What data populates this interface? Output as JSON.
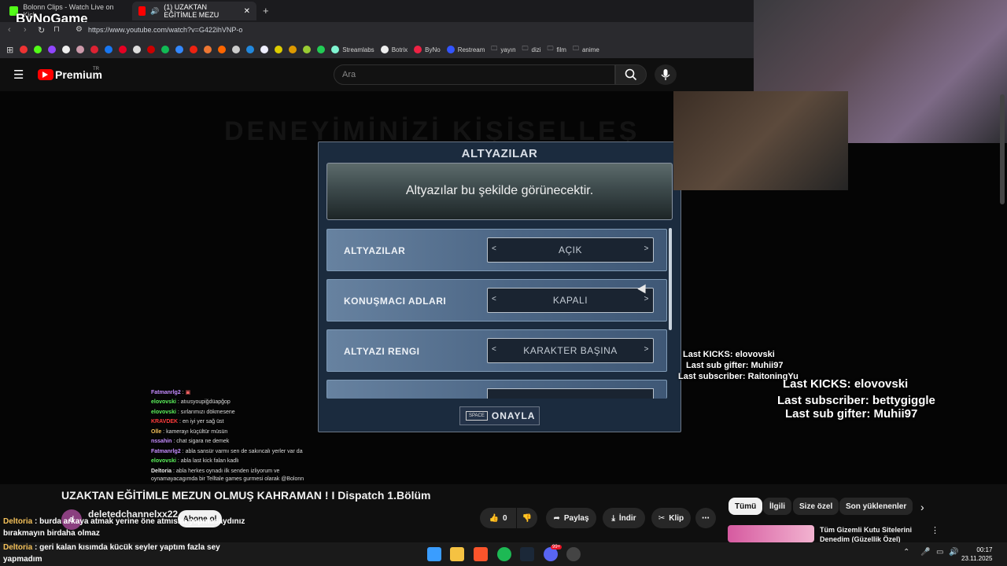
{
  "browser": {
    "tabs": [
      {
        "label": "Bolonn Clips - Watch Live on Kick"
      },
      {
        "label": "(1) UZAKTAN EĞİTİMLE MEZU"
      }
    ],
    "url": "https://www.youtube.com/watch?v=G422ihVNP-o",
    "bookmarks": [
      "Streamlabs",
      "Botrix",
      "ByNo",
      "Restream",
      "yayın",
      "dizi",
      "film",
      "anime"
    ]
  },
  "overlay": {
    "brand": "ByNoGame",
    "kick_small": [
      "Last KICKS: elovovski",
      "Last sub gifter: Muhii97",
      "Last subscriber: RaitoningYu"
    ],
    "kick_large": [
      "Last KICKS: elovovski",
      "Last subscriber: bettygiggle",
      "Last sub gifter: Muhii97"
    ],
    "chat": [
      {
        "user": "Fatmanrlg2",
        "msg": ""
      },
      {
        "user": "elovovski",
        "msg": "atıusyoupiğdüapğop"
      },
      {
        "user": "elovovski",
        "msg": "sırlarımızı dökmesene"
      },
      {
        "user": "KRAVDEK",
        "msg": "en iyi yer sağ üst"
      },
      {
        "user": "Olle",
        "msg": "kamerayı küçültür müsün"
      },
      {
        "user": "nssahin",
        "msg": "chat sigara ne demek"
      },
      {
        "user": "Fatmanrlg2",
        "msg": "abla sansür varmı sen de sakıncalı yerler var da"
      },
      {
        "user": "elovovski",
        "msg": "abla last kick falan kadlı"
      },
      {
        "user": "Deltoria",
        "msg": "abla herkes oynadı ilk senden izliyorum ve"
      },
      {
        "user": "",
        "msg": "oynamayacagımda bir Telltale games gurmesi olarak @Bolonn"
      }
    ],
    "bottom_chat": [
      {
        "user": "Deltoria",
        "msg": "burda arkaya atmak yerine öne atmısım yapmasaydınız bırakmayın birdaha olmaz"
      },
      {
        "user": "Deltoria",
        "msg": "geri kalan kısımda kücük seyler yaptım fazla sey yapmadım"
      }
    ]
  },
  "youtube": {
    "logo": "Premium",
    "logo_sup": "TR",
    "search_placeholder": "Ara",
    "bg_title": "DENEYİMİNİZİ KİŞİSELLEŞ",
    "video_title": "UZAKTAN EĞİTİMLE MEZUN OLMUŞ KAHRAMAN ! I Dispatch 1.Bölüm",
    "channel_initial": "d",
    "channel": "deletedchannelxx22",
    "subscribe": "Abone ol",
    "likes": "0",
    "share": "Paylaş",
    "download": "İndir",
    "clip": "Klip",
    "chips": [
      "Tümü",
      "İlgili",
      "Size özel",
      "Son yüklenenler"
    ],
    "rec_title": "Tüm Gizemli Kutu Sitelerini Denedim (Güzellik Özel)"
  },
  "dialog": {
    "title": "ALTYAZILAR",
    "preview_text": "Altyazılar bu şekilde görünecektir.",
    "rows": [
      {
        "label": "ALTYAZILAR",
        "value": "AÇIK"
      },
      {
        "label": "KONUŞMACI ADLARI",
        "value": "KAPALI"
      },
      {
        "label": "ALTYAZI RENGI",
        "value": "KARAKTER BAŞINA"
      }
    ],
    "confirm_key": "SPACE",
    "confirm_label": "ONAYLA"
  },
  "taskbar": {
    "time": "00:17",
    "date": "23.11.2025",
    "badge": "99+"
  }
}
